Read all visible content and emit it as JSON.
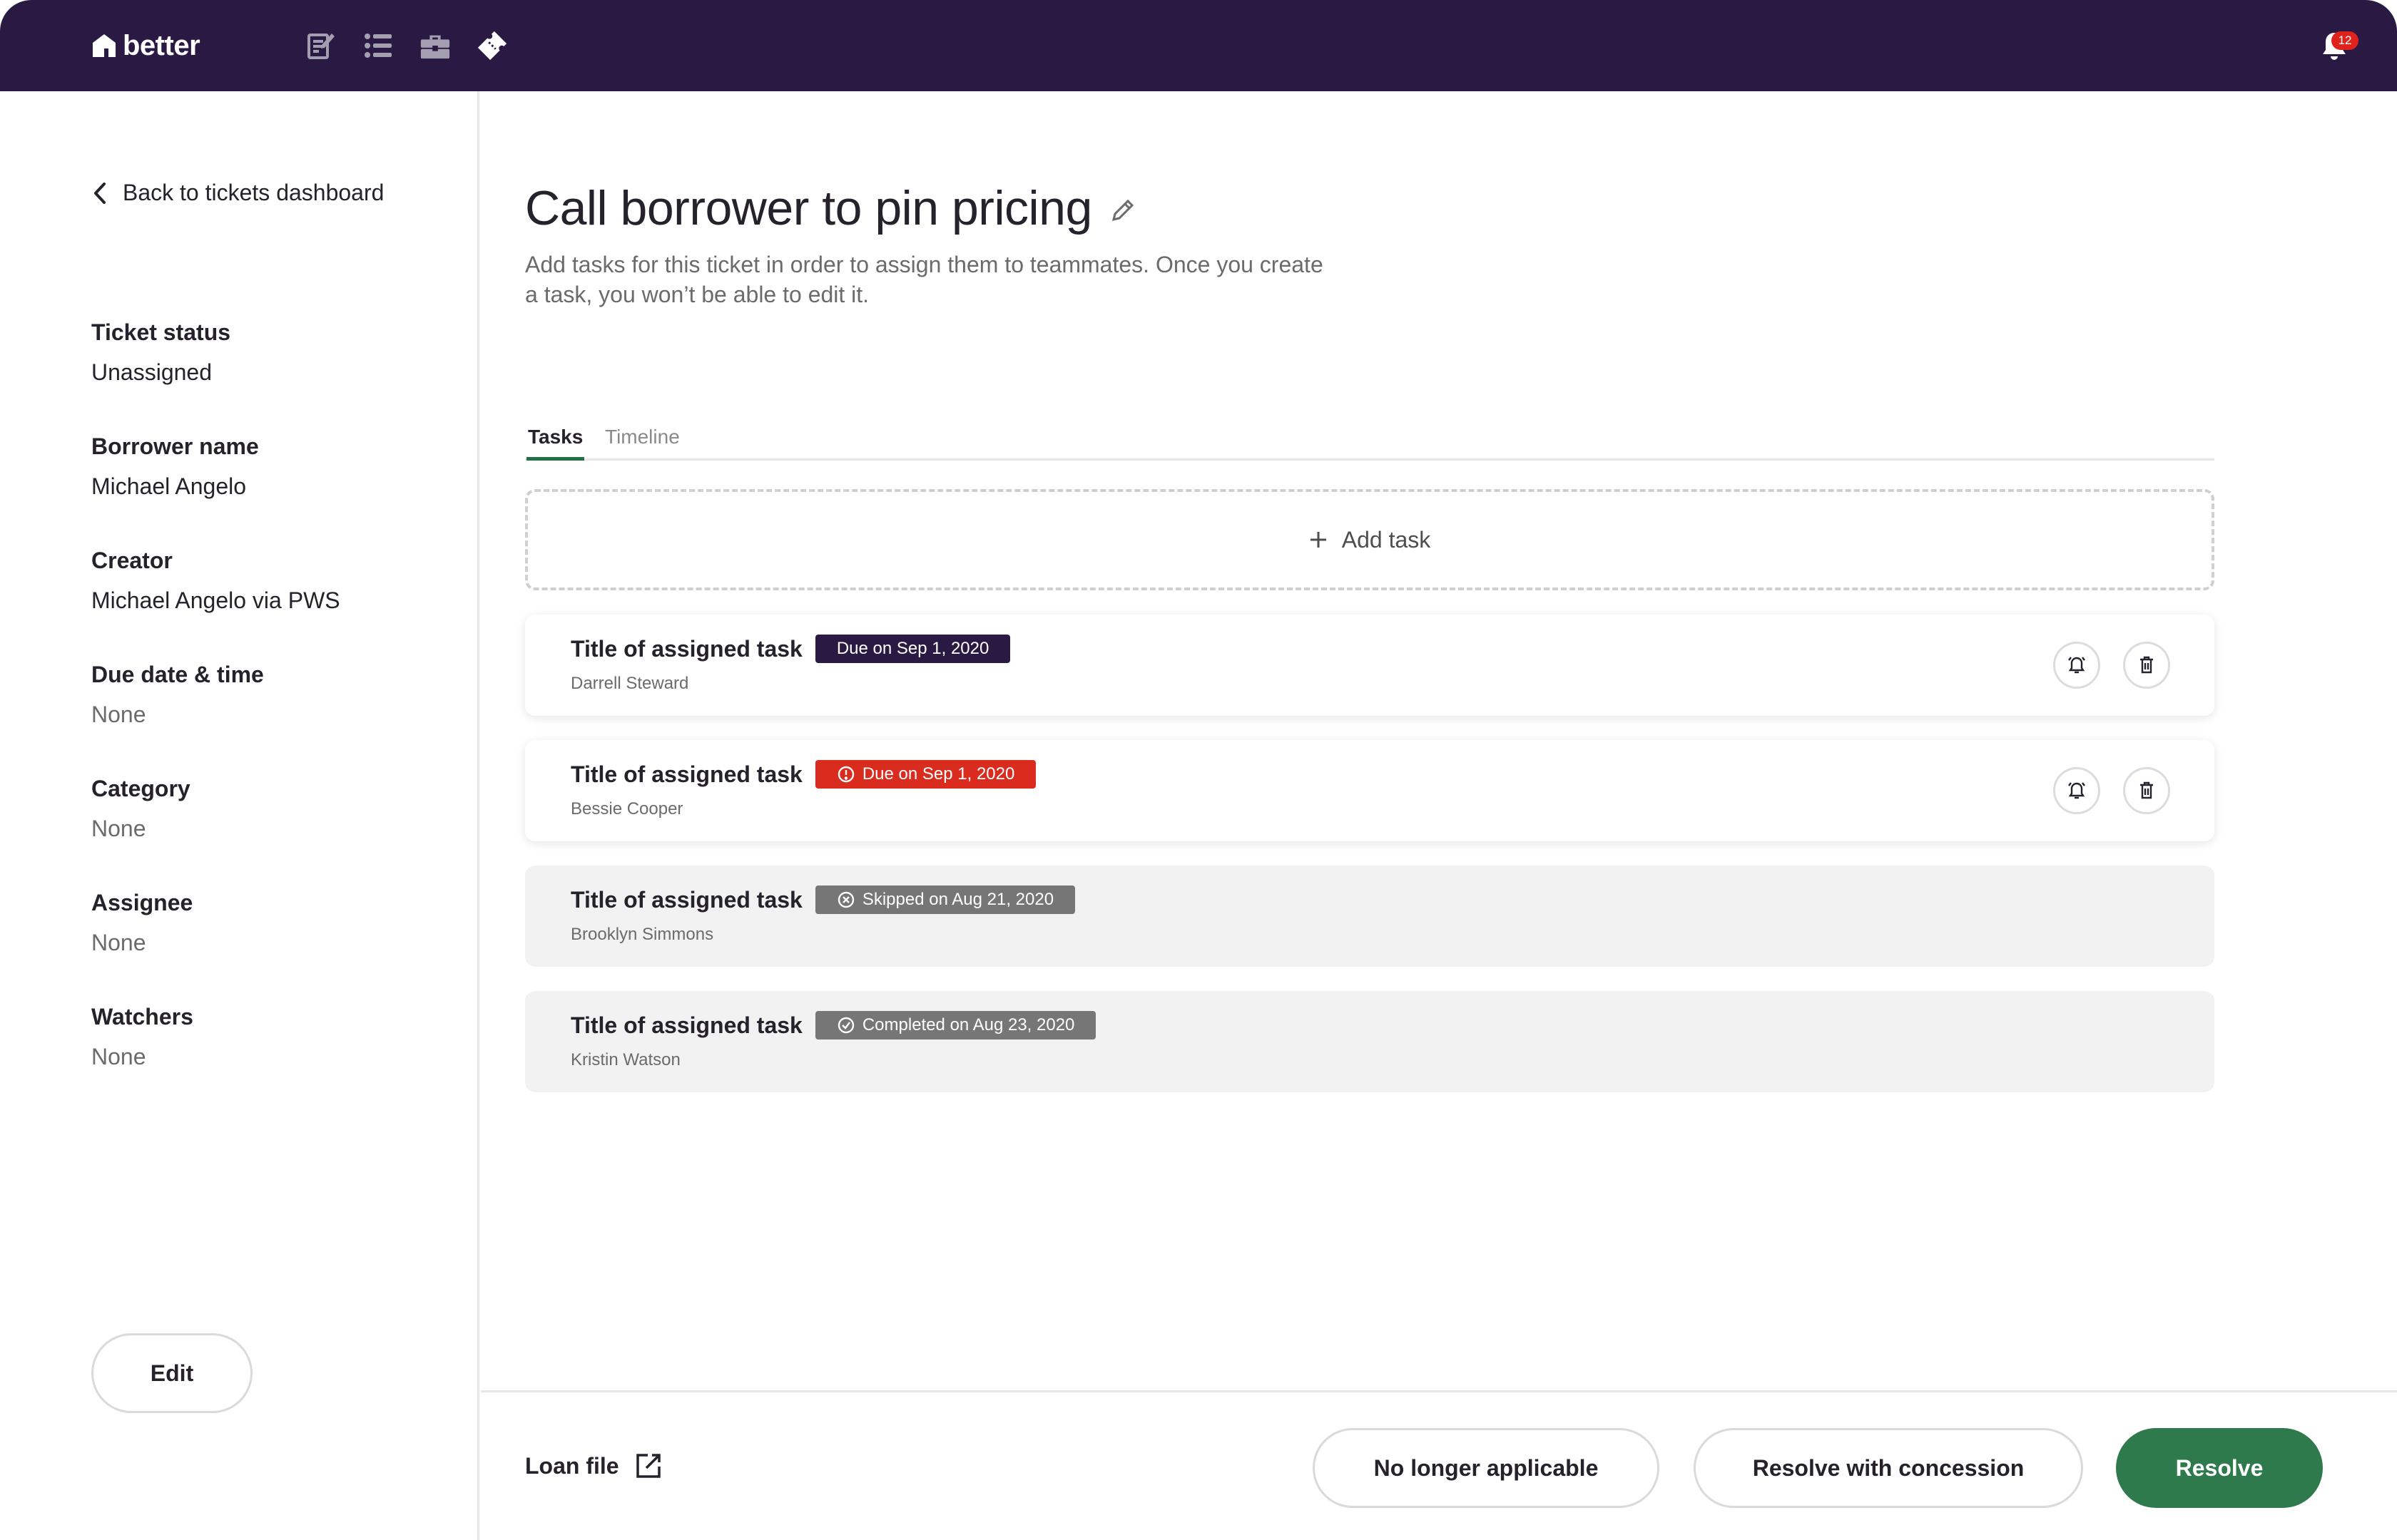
{
  "colors": {
    "nav_bg": "#2a1a43",
    "accent_green": "#2f7a4d",
    "overdue_red": "#d92b1e",
    "due_navy": "#2a1a43",
    "closed_gray": "#767676"
  },
  "topbar": {
    "brand": "better",
    "icons": [
      "notes-icon",
      "list-icon",
      "briefcase-icon",
      "ticket-icon"
    ],
    "notification_count": "12"
  },
  "sidebar": {
    "back_label": "Back to tickets dashboard",
    "fields": [
      {
        "label": "Ticket status",
        "value": "Unassigned"
      },
      {
        "label": "Borrower name",
        "value": "Michael Angelo"
      },
      {
        "label": "Creator",
        "value": "Michael Angelo via PWS"
      },
      {
        "label": "Due date & time",
        "value": "None"
      },
      {
        "label": "Category",
        "value": "None"
      },
      {
        "label": "Assignee",
        "value": "None"
      },
      {
        "label": "Watchers",
        "value": "None"
      }
    ],
    "edit_label": "Edit"
  },
  "main": {
    "title": "Call borrower to pin pricing",
    "subtitle": "Add tasks for this ticket in order to assign them to teammates. Once you create a task, you won’t be able to edit it.",
    "tabs": [
      {
        "label": "Tasks",
        "active": true
      },
      {
        "label": "Timeline",
        "active": false
      }
    ],
    "add_task_label": "Add task",
    "tasks": [
      {
        "title": "Title of assigned task",
        "status": "Due on Sep 1, 2020",
        "assignee": "Darrell Steward",
        "state": "due"
      },
      {
        "title": "Title of assigned task",
        "status": "Due on Sep 1, 2020",
        "assignee": "Bessie Cooper",
        "state": "overdue"
      },
      {
        "title": "Title of assigned task",
        "status": "Skipped on Aug 21, 2020",
        "assignee": "Brooklyn Simmons",
        "state": "skipped"
      },
      {
        "title": "Title of assigned task",
        "status": "Completed on Aug 23, 2020",
        "assignee": "Kristin Watson",
        "state": "completed"
      }
    ]
  },
  "footer": {
    "loan_file_label": "Loan file",
    "no_longer_applicable_label": "No longer applicable",
    "resolve_concession_label": "Resolve with concession",
    "resolve_label": "Resolve"
  }
}
